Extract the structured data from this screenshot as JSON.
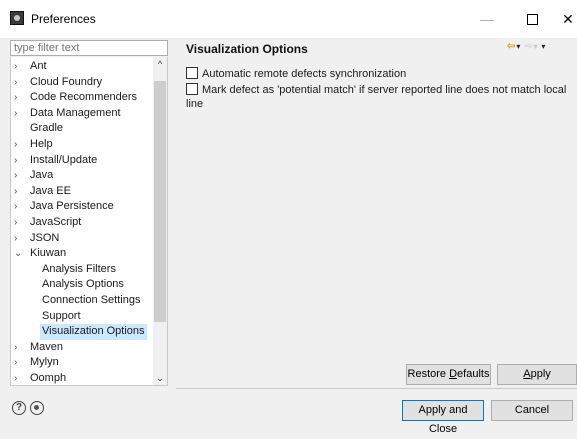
{
  "window": {
    "title": "Preferences",
    "controls": {
      "minimize": "—",
      "close": "✕"
    }
  },
  "filter": {
    "placeholder": "type filter text"
  },
  "tree": {
    "items": [
      {
        "label": "Ant",
        "expander": "›"
      },
      {
        "label": "Cloud Foundry",
        "expander": "›"
      },
      {
        "label": "Code Recommenders",
        "expander": "›"
      },
      {
        "label": "Data Management",
        "expander": "›"
      },
      {
        "label": "Gradle",
        "expander": ""
      },
      {
        "label": "Help",
        "expander": "›"
      },
      {
        "label": "Install/Update",
        "expander": "›"
      },
      {
        "label": "Java",
        "expander": "›"
      },
      {
        "label": "Java EE",
        "expander": "›"
      },
      {
        "label": "Java Persistence",
        "expander": "›"
      },
      {
        "label": "JavaScript",
        "expander": "›"
      },
      {
        "label": "JSON",
        "expander": "›"
      },
      {
        "label": "Kiuwan",
        "expander": "⌄"
      },
      {
        "label": "Analysis Filters",
        "expander": ""
      },
      {
        "label": "Analysis Options",
        "expander": ""
      },
      {
        "label": "Connection Settings",
        "expander": ""
      },
      {
        "label": "Support",
        "expander": ""
      },
      {
        "label": "Visualization Options",
        "expander": ""
      },
      {
        "label": "Maven",
        "expander": "›"
      },
      {
        "label": "Mylyn",
        "expander": "›"
      },
      {
        "label": "Oomph",
        "expander": "›"
      }
    ],
    "scroll_up": "^",
    "scroll_down": "⌄"
  },
  "page": {
    "title": "Visualization Options",
    "nav": {
      "back": "⇦",
      "back_menu": "▾",
      "forward": "⇨",
      "forward_menu": "▾",
      "view_menu": "▾"
    },
    "options": [
      {
        "label": "Automatic remote defects synchronization",
        "checked": false
      },
      {
        "label": "Mark defect as 'potential match' if server reported line does not match local line",
        "checked": false
      }
    ]
  },
  "buttons": {
    "restore_defaults_pre": "Restore ",
    "restore_defaults_mn": "D",
    "restore_defaults_post": "efaults",
    "apply_mn": "A",
    "apply_post": "pply",
    "apply_and_close": "Apply and Close",
    "cancel": "Cancel"
  },
  "footer": {
    "help_glyph": "?"
  }
}
